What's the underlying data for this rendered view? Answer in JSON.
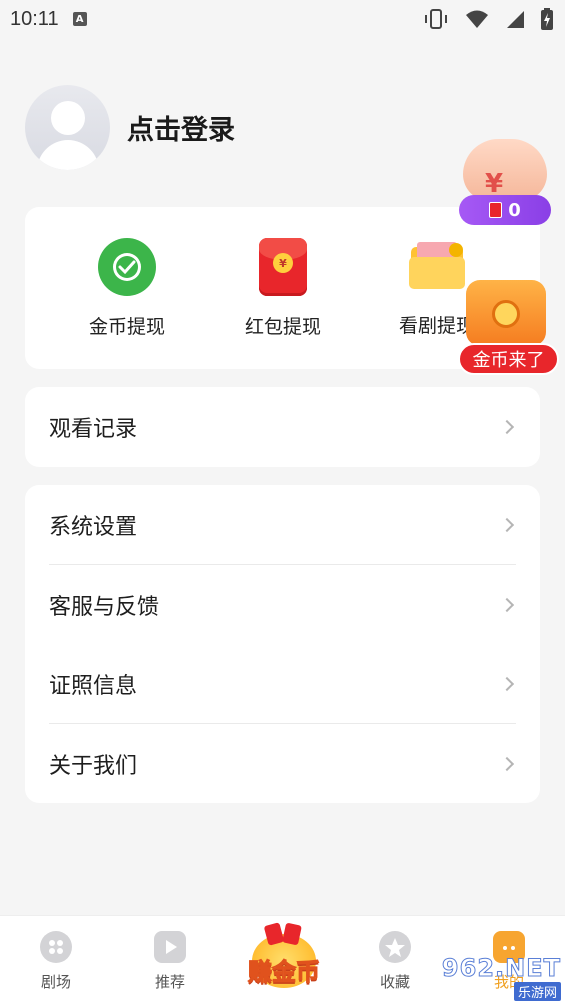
{
  "status_bar": {
    "time": "10:11",
    "notification_badge": "A"
  },
  "profile": {
    "login_label": "点击登录"
  },
  "wallet": [
    {
      "label": "金币提现",
      "icon": "coin-withdraw-icon"
    },
    {
      "label": "红包提现",
      "icon": "red-envelope-icon"
    },
    {
      "label": "看剧提现",
      "icon": "folder-icon"
    }
  ],
  "red_envelope_seal": "¥",
  "float_pig": {
    "yen": "¥",
    "count": "0"
  },
  "float_chest": {
    "label": "金币来了"
  },
  "menu_history": {
    "label": "观看记录"
  },
  "menu_settings": [
    {
      "label": "系统设置"
    },
    {
      "label": "客服与反馈"
    },
    {
      "label": "证照信息"
    },
    {
      "label": "关于我们"
    }
  ],
  "bottom_nav": {
    "theater": "剧场",
    "recommend": "推荐",
    "earn": "赚金币",
    "favorites": "收藏",
    "mine": "我的"
  },
  "watermark": {
    "big": "962.NET",
    "small": "乐游网"
  },
  "colors": {
    "accent_red": "#e8262b",
    "green": "#3cb54a",
    "purple": "#9a4cf0",
    "bg": "#f5f5f5"
  }
}
